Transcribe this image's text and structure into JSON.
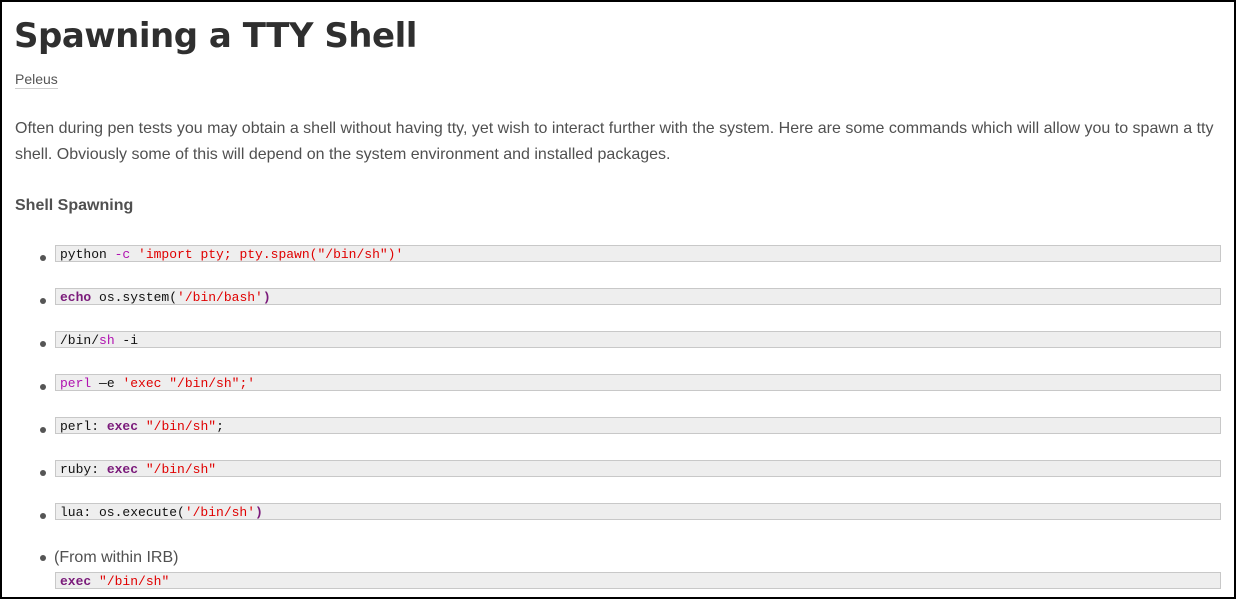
{
  "article": {
    "title": "Spawning a TTY Shell",
    "author": "Peleus",
    "intro": "Often during pen tests you may obtain a shell without having tty, yet wish to interact further with the system. Here are some commands which will allow you to spawn a tty shell. Obviously some of this will depend on the system environment and installed packages.",
    "section_heading": "Shell Spawning"
  },
  "commands": [
    {
      "parts": [
        {
          "t": "python ",
          "c": "pl"
        },
        {
          "t": "-c",
          "c": "kw2"
        },
        {
          "t": " ",
          "c": "pl"
        },
        {
          "t": "'import pty; pty.spawn(\"/bin/sh\")'",
          "c": "str"
        }
      ]
    },
    {
      "parts": [
        {
          "t": "echo",
          "c": "kw"
        },
        {
          "t": " os.system(",
          "c": "pl"
        },
        {
          "t": "'/bin/bash'",
          "c": "str"
        },
        {
          "t": ")",
          "c": "kw"
        }
      ]
    },
    {
      "parts": [
        {
          "t": "/bin/",
          "c": "pl"
        },
        {
          "t": "sh",
          "c": "kw2"
        },
        {
          "t": " -i",
          "c": "pl"
        }
      ]
    },
    {
      "parts": [
        {
          "t": "perl",
          "c": "kw2"
        },
        {
          "t": " —e ",
          "c": "pl"
        },
        {
          "t": "'exec \"/bin/sh\";'",
          "c": "str"
        }
      ]
    },
    {
      "parts": [
        {
          "t": "perl: ",
          "c": "pl"
        },
        {
          "t": "exec",
          "c": "kw"
        },
        {
          "t": " ",
          "c": "pl"
        },
        {
          "t": "\"/bin/sh\"",
          "c": "str"
        },
        {
          "t": ";",
          "c": "pl"
        }
      ]
    },
    {
      "parts": [
        {
          "t": "ruby: ",
          "c": "pl"
        },
        {
          "t": "exec",
          "c": "kw"
        },
        {
          "t": " ",
          "c": "pl"
        },
        {
          "t": "\"/bin/sh\"",
          "c": "str"
        }
      ]
    },
    {
      "parts": [
        {
          "t": "lua: os.execute(",
          "c": "pl"
        },
        {
          "t": "'/bin/sh'",
          "c": "str"
        },
        {
          "t": ")",
          "c": "kw"
        }
      ]
    }
  ],
  "irb": {
    "label": "(From within IRB)",
    "parts": [
      {
        "t": "exec",
        "c": "kw"
      },
      {
        "t": " ",
        "c": "pl"
      },
      {
        "t": "\"/bin/sh\"",
        "c": "str"
      }
    ]
  },
  "colors": {
    "keyword": "#7a1a7a",
    "option": "#b012b0",
    "string": "#e00000",
    "code_background": "#eeeeee"
  }
}
